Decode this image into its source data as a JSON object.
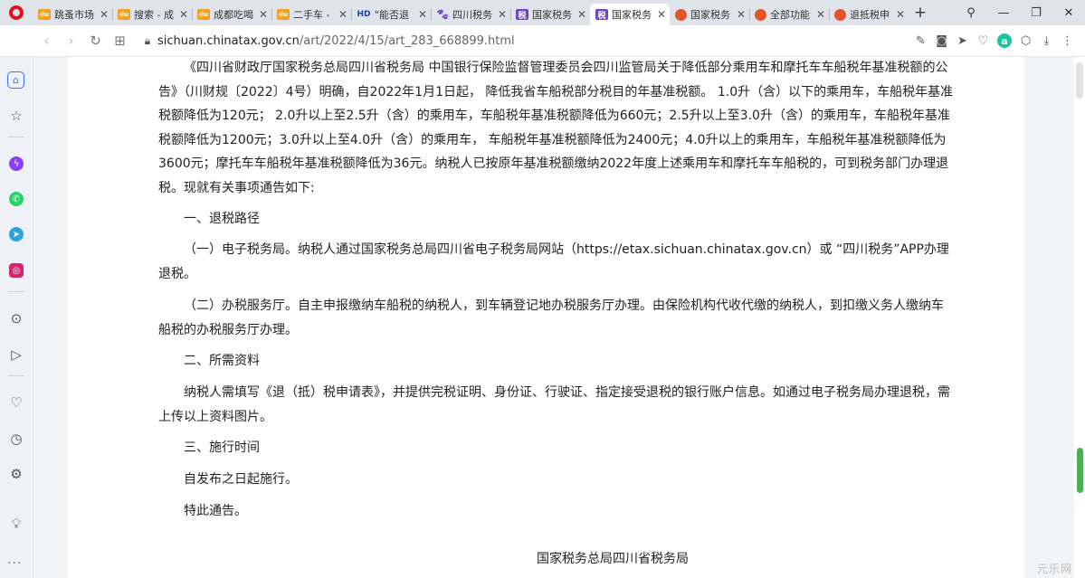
{
  "tabs": [
    {
      "label": "跳蚤市场",
      "favicon": "baidu"
    },
    {
      "label": "搜索 - 成",
      "favicon": "baidu"
    },
    {
      "label": "成都吃喝",
      "favicon": "baidu"
    },
    {
      "label": "二手车 -",
      "favicon": "baidu"
    },
    {
      "label": "\"能否退",
      "favicon": "hd"
    },
    {
      "label": "四川税务",
      "favicon": "paw"
    },
    {
      "label": "国家税务",
      "favicon": "tax"
    },
    {
      "label": "国家税务",
      "favicon": "tax",
      "active": true
    },
    {
      "label": "国家税务",
      "favicon": "shield"
    },
    {
      "label": "全部功能",
      "favicon": "shield"
    },
    {
      "label": "退抵税申",
      "favicon": "shield"
    }
  ],
  "address": {
    "host": "sichuan.chinatax.gov.cn",
    "path": "/art/2022/4/15/art_283_668899.html"
  },
  "article": {
    "intro": "《四川省财政厅国家税务总局四川省税务局 中国银行保险监督管理委员会四川监管局关于降低部分乘用车和摩托车车船税年基准税额的公告》（川财规〔2022〕4号）明确，自2022年1月1日起， 降低我省车船税部分税目的年基准税额。 1.0升（含）以下的乘用车，车船税年基准税额降低为120元； 2.0升以上至2.5升（含）的乘用车，车船税年基准税额降低为660元；2.5升以上至3.0升（含）的乘用车，车船税年基准税额降低为1200元；3.0升以上至4.0升（含）的乘用车， 车船税年基准税额降低为2400元；4.0升以上的乘用车，车船税年基准税额降低为3600元；摩托车车船税年基准税额降低为36元。纳税人已按原年基准税额缴纳2022年度上述乘用车和摩托车车船税的，可到税务部门办理退税。现就有关事项通告如下:",
    "section1": "一、退税路径",
    "item1": "（一）电子税务局。纳税人通过国家税务总局四川省电子税务局网站（https://etax.sichuan.chinatax.gov.cn）或 “四川税务”APP办理退税。",
    "item2": "（二）办税服务厅。自主申报缴纳车船税的纳税人，到车辆登记地办税服务厅办理。由保险机构代收代缴的纳税人，到扣缴义务人缴纳车船税的办税服务厅办理。",
    "section2": "二、所需资料",
    "materials": "纳税人需填写《退（抵）税申请表》，并提供完税证明、身份证、行驶证、指定接受退税的银行账户信息。如通过电子税务局办理退税，需上传以上资料图片。",
    "section3": "三、施行时间",
    "effective": "自发布之日起施行。",
    "closing": "特此通告。",
    "signature": "国家税务总局四川省税务局"
  },
  "watermark": "元乐网",
  "colors": {
    "accent": "#3478f6",
    "opera_red": "#e0141e",
    "scroll_thumb": "#4caf50"
  }
}
